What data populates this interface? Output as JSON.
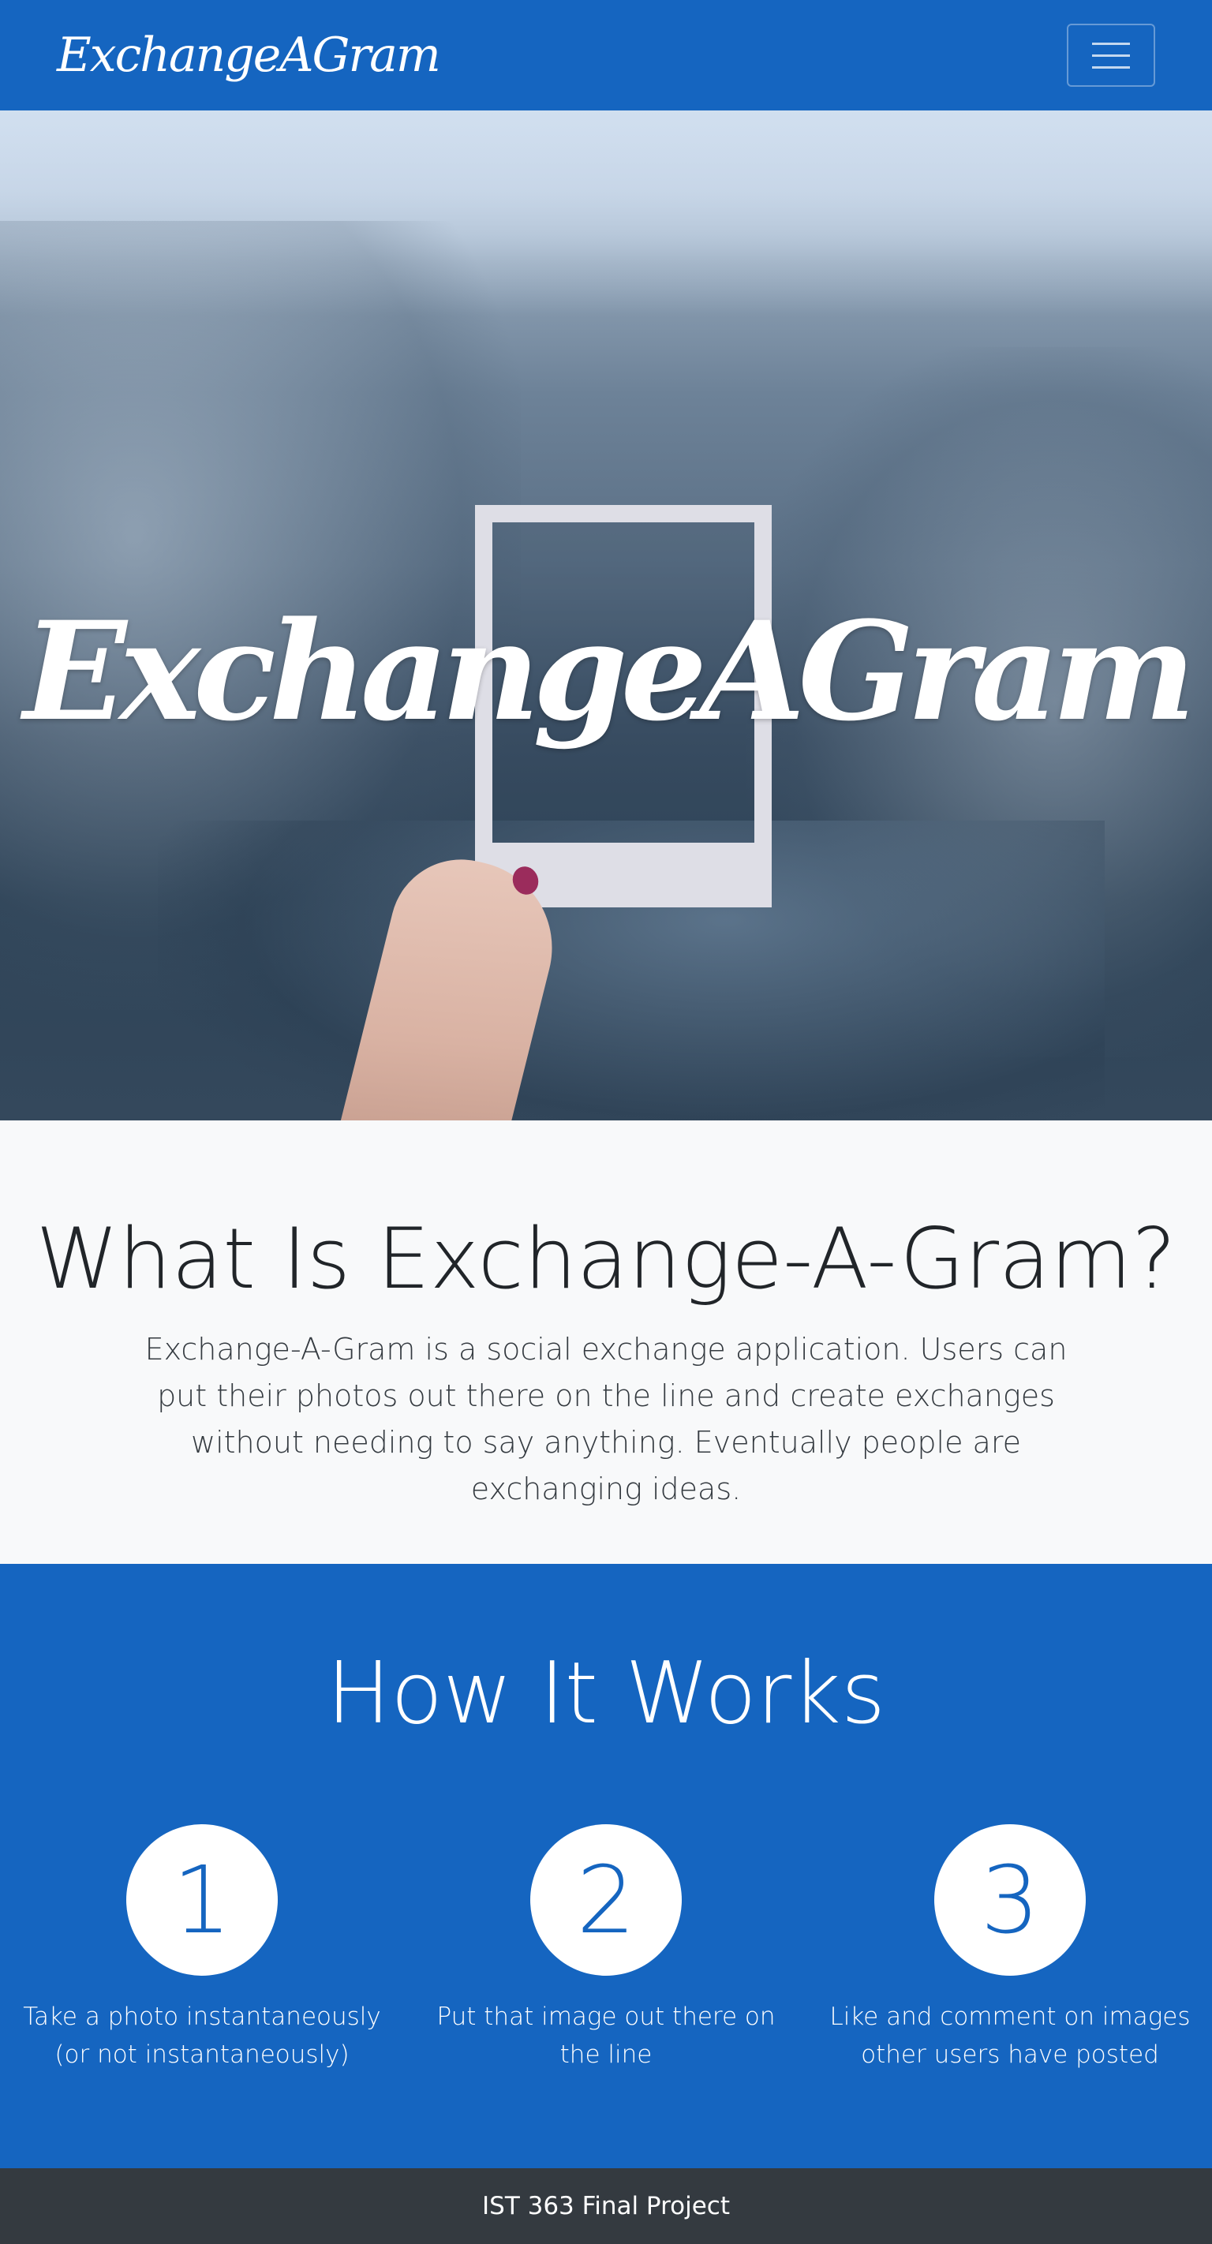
{
  "navbar": {
    "brand": "ExchangeAGram",
    "toggle_icon": "hamburger-menu-icon",
    "background": "#1565c0"
  },
  "hero": {
    "title": "ExchangeAGram",
    "image_subject": "hand holding empty photo frame over mountain lake"
  },
  "about": {
    "heading": "What Is Exchange-A-Gram?",
    "text": "Exchange-A-Gram is a social exchange application. Users can put their photos out there on the line and create exchanges without needing to say anything. Eventually people are exchanging ideas."
  },
  "how": {
    "heading": "How It Works",
    "steps": [
      {
        "number": "1",
        "text": "Take a photo instantaneously (or not instantaneously)"
      },
      {
        "number": "2",
        "text": "Put that image out there on the line"
      },
      {
        "number": "3",
        "text": "Like and comment on images other users have posted"
      }
    ]
  },
  "footer": {
    "text": "IST 363 Final Project"
  },
  "colors": {
    "primary": "#1565c0",
    "footer": "#343a40",
    "light": "#f8f9fa"
  }
}
